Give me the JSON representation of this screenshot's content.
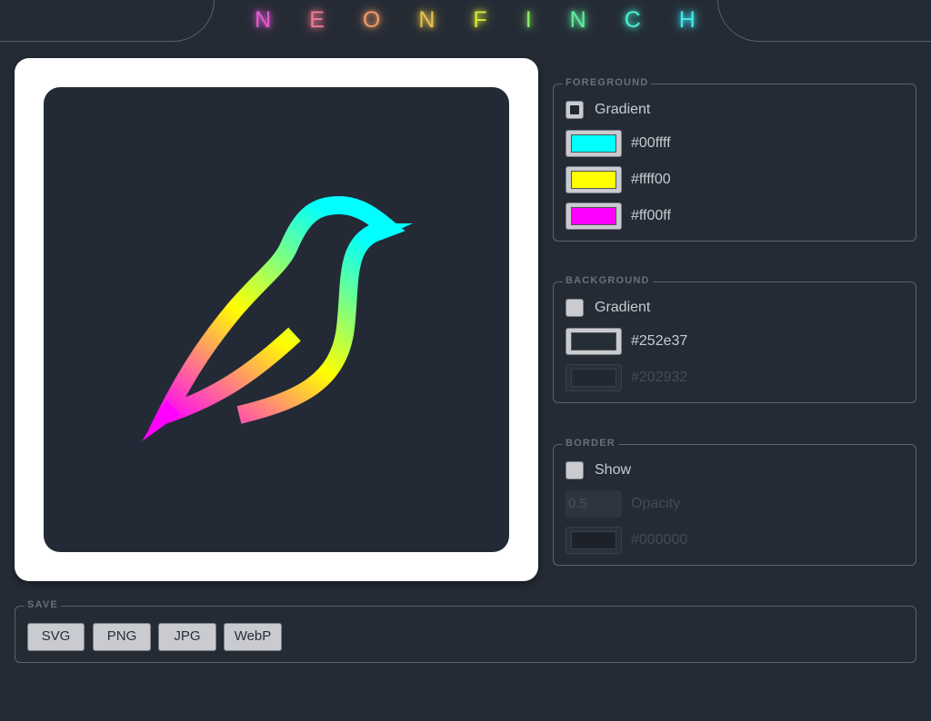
{
  "app": {
    "title_letters": [
      "N",
      "E",
      "O",
      "N",
      "F",
      "I",
      "N",
      "C",
      "H"
    ],
    "title_colors": [
      "#e25bd0",
      "#f07a8f",
      "#f39a68",
      "#e8c24a",
      "#d8e83a",
      "#8ef060",
      "#5ef0a0",
      "#48f0d0",
      "#40e8f0"
    ]
  },
  "foreground": {
    "legend": "FOREGROUND",
    "gradient_label": "Gradient",
    "gradient_checked": true,
    "colors": [
      {
        "hex": "#00ffff",
        "label": "#00ffff"
      },
      {
        "hex": "#ffff00",
        "label": "#ffff00"
      },
      {
        "hex": "#ff00ff",
        "label": "#ff00ff"
      }
    ]
  },
  "background": {
    "legend": "BACKGROUND",
    "gradient_label": "Gradient",
    "gradient_checked": false,
    "colors": [
      {
        "hex": "#252e37",
        "label": "#252e37",
        "enabled": true
      },
      {
        "hex": "#202932",
        "label": "#202932",
        "enabled": false
      }
    ]
  },
  "border": {
    "legend": "BORDER",
    "show_label": "Show",
    "show_checked": false,
    "opacity_value": "0.5",
    "opacity_label": "Opacity",
    "color_hex": "#000000",
    "color_label": "#000000"
  },
  "save": {
    "legend": "SAVE",
    "buttons": [
      "SVG",
      "PNG",
      "JPG",
      "WebP"
    ]
  },
  "logo": {
    "name": "finch-logo",
    "gradient": [
      "#00ffff",
      "#ffff00",
      "#ff00ff"
    ],
    "background": "#232a35"
  }
}
